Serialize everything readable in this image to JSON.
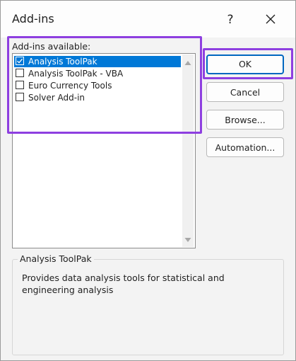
{
  "dialog": {
    "title": "Add-ins",
    "help_label": "?",
    "list_label": "Add-ins available:",
    "addins": [
      {
        "label": "Analysis ToolPak",
        "checked": true,
        "selected": true
      },
      {
        "label": "Analysis ToolPak - VBA",
        "checked": false,
        "selected": false
      },
      {
        "label": "Euro Currency Tools",
        "checked": false,
        "selected": false
      },
      {
        "label": "Solver Add-in",
        "checked": false,
        "selected": false
      }
    ],
    "buttons": {
      "ok": "OK",
      "cancel": "Cancel",
      "browse": "Browse...",
      "automation": "Automation..."
    },
    "description_group": {
      "title": "Analysis ToolPak",
      "text": "Provides data analysis tools for statistical and engineering analysis"
    }
  },
  "colors": {
    "selection": "#0078d7",
    "highlight": "#8e3fe0",
    "default_button_border": "#0067c0"
  }
}
